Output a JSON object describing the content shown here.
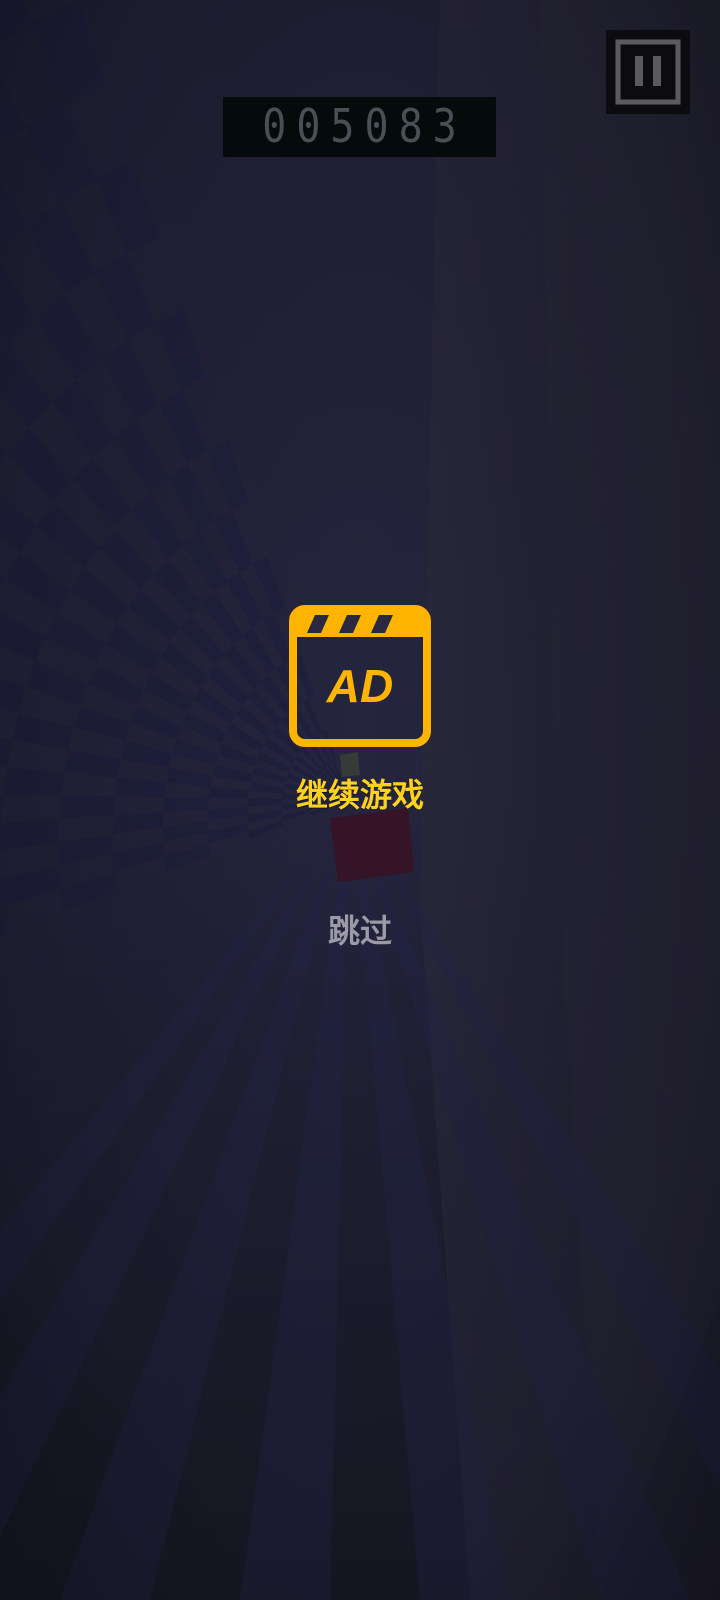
{
  "hud": {
    "score": "005083",
    "pause_icon": "pause-icon"
  },
  "ad_prompt": {
    "icon": "ad-clapperboard-icon",
    "icon_text": "AD",
    "continue_label": "继续游戏",
    "skip_label": "跳过"
  },
  "colors": {
    "accent": "#ffb400",
    "continue_text": "#ffd21e",
    "skip_text": "#9c9aa6",
    "background": "#1d1c2c"
  }
}
